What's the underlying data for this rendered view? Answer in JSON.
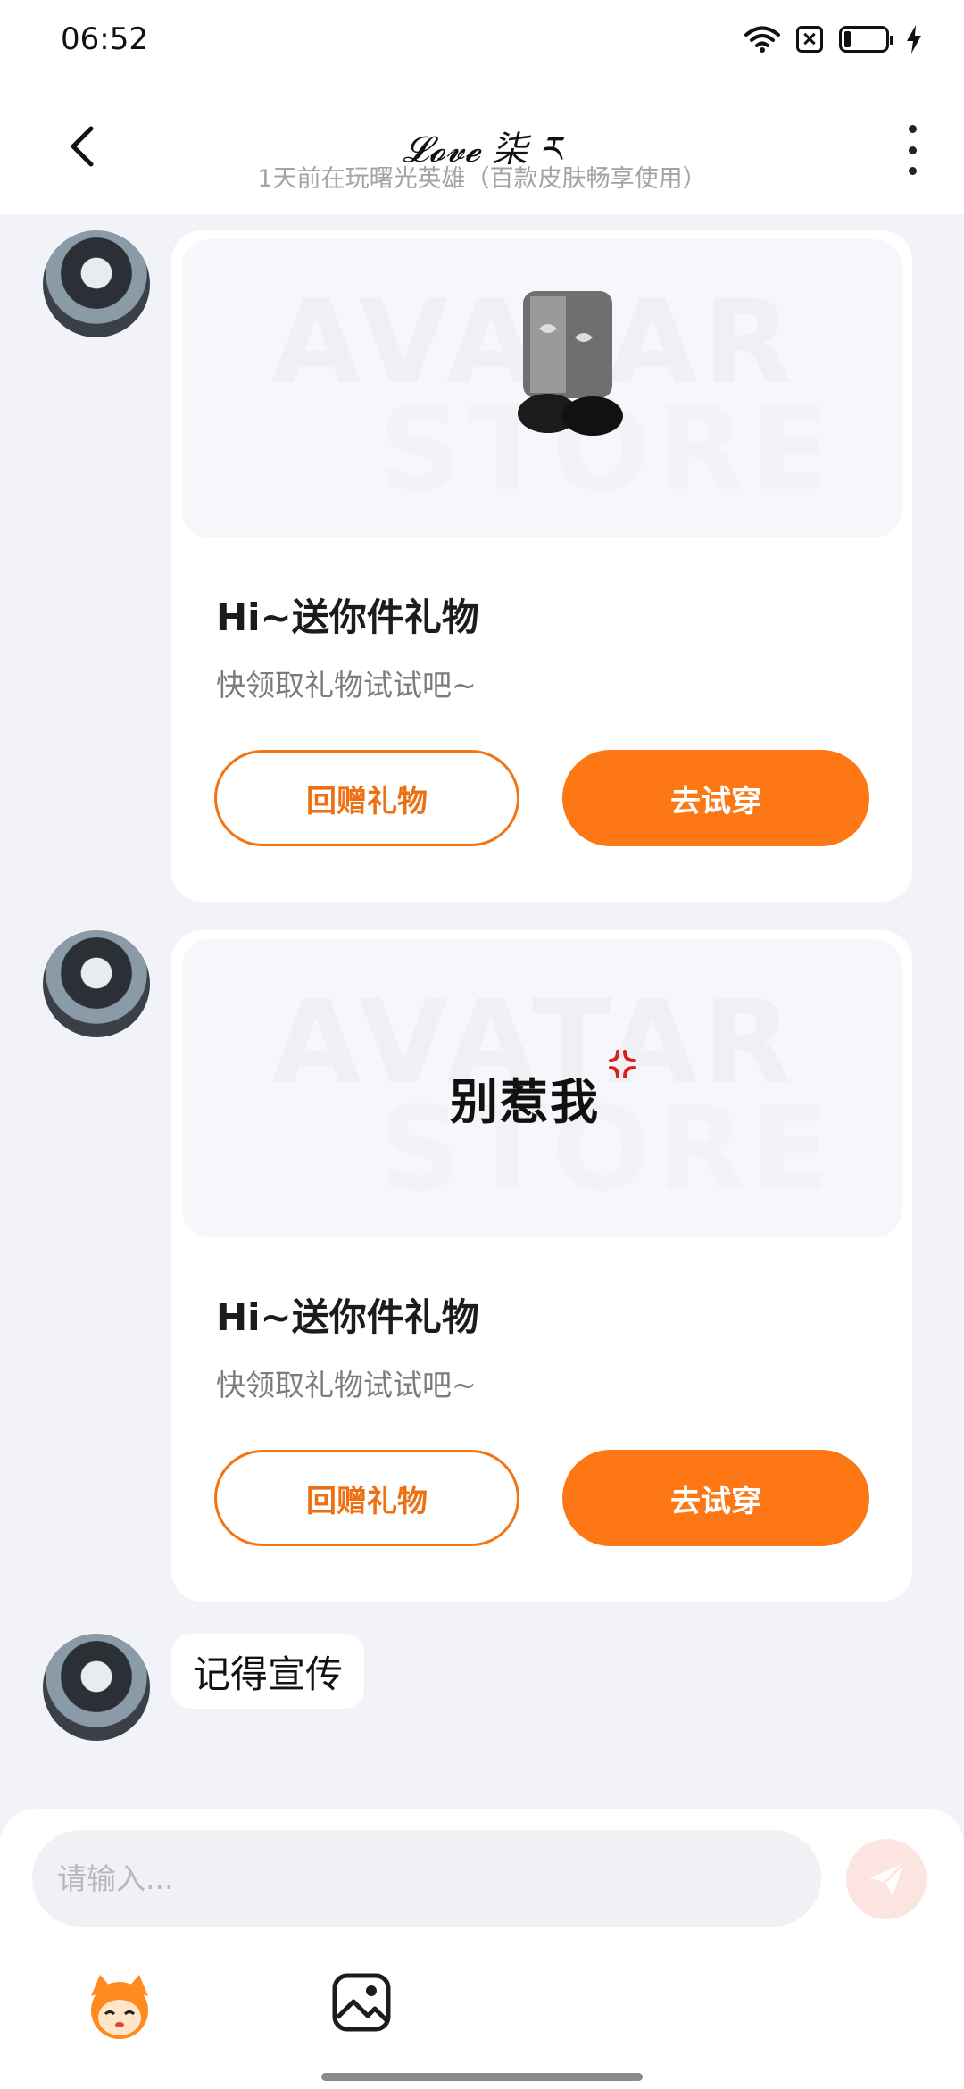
{
  "status_bar": {
    "time": "06:52"
  },
  "header": {
    "title": "𝓛𝓸𝓿𝓮 柒 ར",
    "subtitle": "1天前在玩曙光英雄（百款皮肤畅享使用）"
  },
  "messages": [
    {
      "type": "gift_card",
      "image_text": "",
      "watermark_top": "AVATAR",
      "watermark_bottom": "STORE",
      "title": "Hi~送你件礼物",
      "description": "快领取礼物试试吧~",
      "return_gift_label": "回赠礼物",
      "try_on_label": "去试穿"
    },
    {
      "type": "gift_card",
      "image_text": "别惹我",
      "watermark_top": "AVATAR",
      "watermark_bottom": "STORE",
      "title": "Hi~送你件礼物",
      "description": "快领取礼物试试吧~",
      "return_gift_label": "回赠礼物",
      "try_on_label": "去试穿"
    },
    {
      "type": "text",
      "text": "记得宣传"
    }
  ],
  "composer": {
    "placeholder": "请输入...",
    "value": ""
  },
  "icons": {
    "back": "chevron-left-icon",
    "more": "more-vertical-icon",
    "send": "send-icon",
    "emoji": "mascot-emoji-icon",
    "image": "image-icon"
  },
  "colors": {
    "accent": "#FD7714",
    "background": "#F2F3F8",
    "send_disabled": "#FCE5E0"
  }
}
